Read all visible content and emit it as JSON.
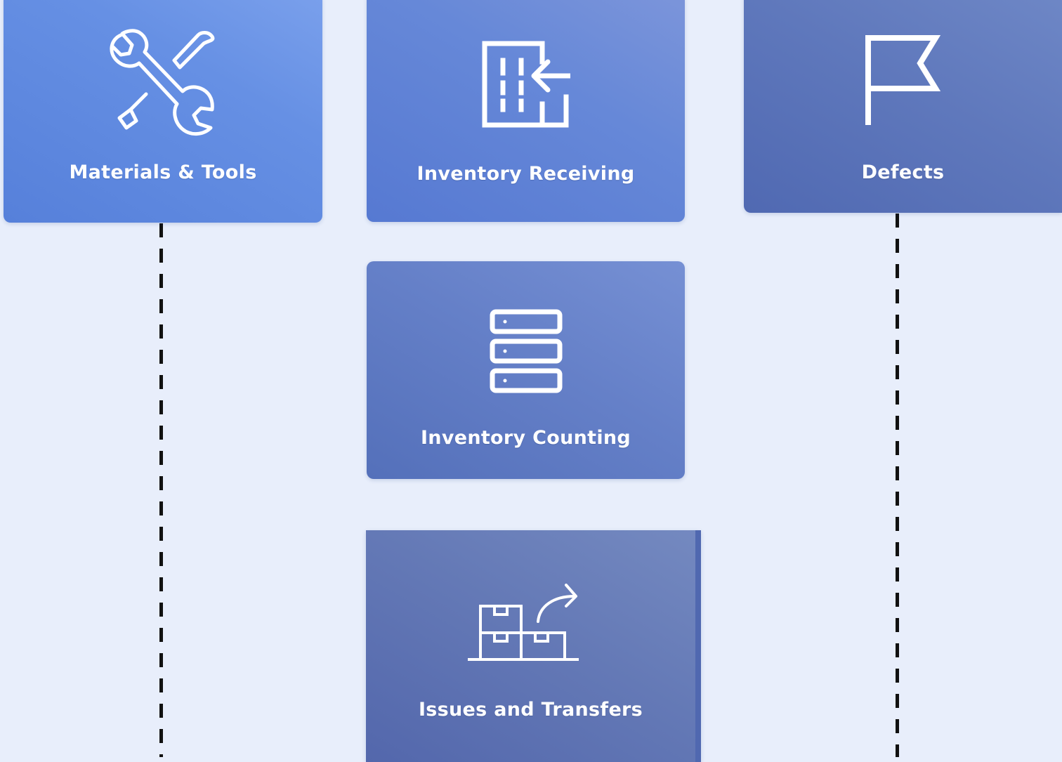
{
  "tiles": {
    "materials_tools": {
      "label": "Materials & Tools",
      "icon": "tools-icon"
    },
    "inventory_receiving": {
      "label": "Inventory Receiving",
      "icon": "building-receive-icon"
    },
    "defects": {
      "label": "Defects",
      "icon": "flag-icon"
    },
    "inventory_counting": {
      "label": "Inventory Counting",
      "icon": "server-stack-icon"
    },
    "issues_transfers": {
      "label": "Issues and Transfers",
      "icon": "boxes-transfer-icon"
    }
  },
  "colors": {
    "background": "#e8eefb",
    "tile_blue_light": "#6690e4",
    "tile_blue_dark": "#5069b2",
    "connector": "#111111",
    "label": "#ffffff"
  }
}
